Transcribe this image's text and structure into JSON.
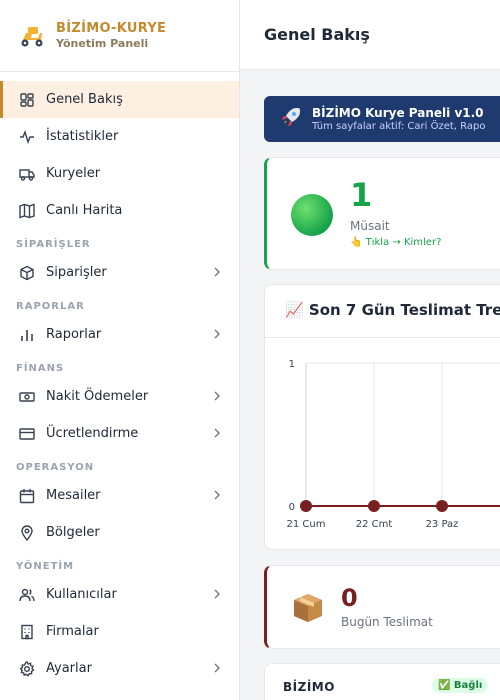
{
  "brand": {
    "name": "BİZİMO-KURYE",
    "subtitle": "Yönetim Paneli"
  },
  "sidebar": {
    "items": [
      {
        "label": "Genel Bakış",
        "icon": "dashboard-icon",
        "active": true
      },
      {
        "label": "İstatistikler",
        "icon": "activity-icon"
      },
      {
        "label": "Kuryeler",
        "icon": "truck-icon"
      },
      {
        "label": "Canlı Harita",
        "icon": "map-icon"
      }
    ],
    "sections": [
      {
        "title": "SİPARİŞLER",
        "items": [
          {
            "label": "Siparişler",
            "icon": "package-icon",
            "expandable": true
          }
        ]
      },
      {
        "title": "RAPORLAR",
        "items": [
          {
            "label": "Raporlar",
            "icon": "bar-chart-icon",
            "expandable": true
          }
        ]
      },
      {
        "title": "FİNANS",
        "items": [
          {
            "label": "Nakit Ödemeler",
            "icon": "cash-icon",
            "expandable": true
          },
          {
            "label": "Ücretlendirme",
            "icon": "credit-card-icon",
            "expandable": true
          }
        ]
      },
      {
        "title": "OPERASYON",
        "items": [
          {
            "label": "Mesailer",
            "icon": "calendar-icon",
            "expandable": true
          },
          {
            "label": "Bölgeler",
            "icon": "map-pin-icon"
          }
        ]
      },
      {
        "title": "YÖNETİM",
        "items": [
          {
            "label": "Kullanıcılar",
            "icon": "users-icon",
            "expandable": true
          },
          {
            "label": "Firmalar",
            "icon": "building-icon"
          },
          {
            "label": "Ayarlar",
            "icon": "gear-icon",
            "expandable": true
          }
        ]
      }
    ]
  },
  "header": {
    "title": "Genel Bakış"
  },
  "banner": {
    "title": "BİZİMO Kurye Paneli v1.0",
    "subtitle": "Tüm sayfalar aktif: Cari Özet, Rapo"
  },
  "available": {
    "count": "1",
    "label": "Müsait",
    "link": "👆 Tıkla → Kimler?"
  },
  "chart": {
    "title": "📈 Son 7 Gün Teslimat Tre"
  },
  "chart_data": {
    "type": "line",
    "categories": [
      "21 Cum",
      "22 Cmt",
      "23 Paz"
    ],
    "values": [
      0,
      0,
      0
    ],
    "ylim": [
      0,
      1
    ],
    "yticks": [
      "0",
      "1"
    ],
    "grid": true,
    "color": "#7a1f1f"
  },
  "today": {
    "count": "0",
    "label": "Bugün Teslimat"
  },
  "company": {
    "name": "BİZİMO",
    "status": "✅ Bağlı"
  }
}
